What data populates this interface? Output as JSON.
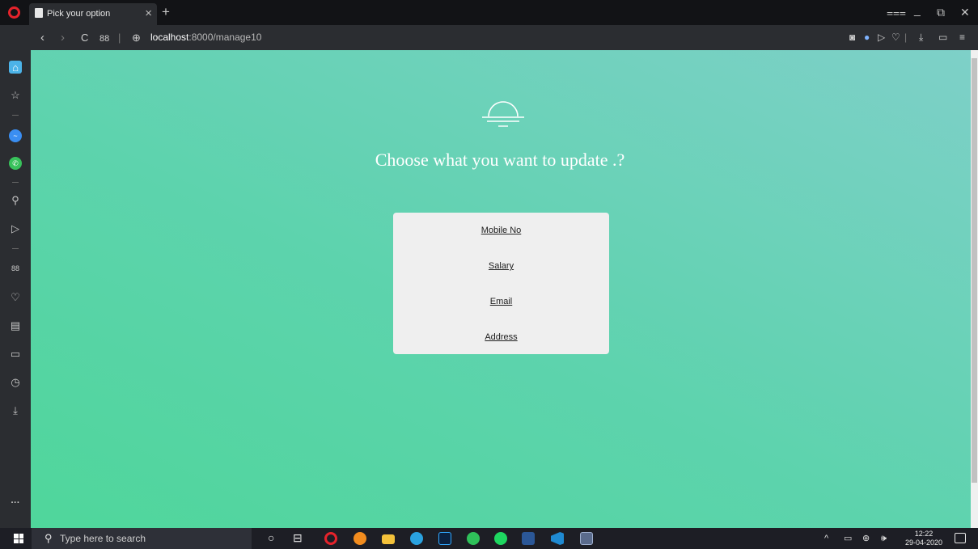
{
  "browser": {
    "tab": {
      "title": "Pick your option",
      "close_label": "×"
    },
    "new_tab_label": "+",
    "window_controls": {
      "menu": "⩶",
      "minimize": "_",
      "restore": "⧉",
      "close": "✕"
    },
    "nav": {
      "back": "‹",
      "forward": "›",
      "reload": "C",
      "speed_dial": "88",
      "separator": "|",
      "site_icon": "⊕"
    },
    "url": {
      "host": "localhost",
      "path": ":8000/manage10"
    },
    "address_icons": {
      "snapshot": "◙",
      "vpn": "●",
      "send": "▷",
      "heart": "♡",
      "divider": "|",
      "download": "⤓",
      "battery": "▭",
      "easy_setup": "≡"
    }
  },
  "sidebar": {
    "items": [
      {
        "name": "home-icon",
        "glyph": "⌂"
      },
      {
        "name": "star-icon",
        "glyph": "☆"
      },
      {
        "name": "messenger-icon",
        "glyph": "~"
      },
      {
        "name": "whatsapp-icon",
        "glyph": "✆"
      },
      {
        "name": "search-icon",
        "glyph": "⚲"
      },
      {
        "name": "send-icon",
        "glyph": "▷"
      },
      {
        "name": "apps-icon",
        "glyph": "88"
      },
      {
        "name": "heart-icon",
        "glyph": "♡"
      },
      {
        "name": "news-icon",
        "glyph": "▤"
      },
      {
        "name": "display-icon",
        "glyph": "▭"
      },
      {
        "name": "history-icon",
        "glyph": "◷"
      },
      {
        "name": "download-icon",
        "glyph": "⤓"
      },
      {
        "name": "more-icon",
        "glyph": "···"
      }
    ]
  },
  "page": {
    "heading": "Choose what you want to update .?",
    "options": [
      "Mobile No",
      "Salary",
      "Email",
      "Address"
    ],
    "colors": {
      "gradient_start": "#4fd69b",
      "gradient_end": "#7ed0c8",
      "card": "#efefef"
    }
  },
  "taskbar": {
    "search_placeholder": "Type here to search",
    "search_icon_glyph": "⚲",
    "cortana_glyph": "○",
    "task_view_glyph": "⊟",
    "apps": [
      "opera",
      "firefox",
      "file-explorer",
      "telegram",
      "photoshop",
      "whatsapp",
      "spotify",
      "word",
      "vscode",
      "snipping"
    ],
    "tray": {
      "chevron": "^",
      "battery": "▭",
      "network": "⊕",
      "volume": "🕪"
    },
    "clock": {
      "time": "12:22",
      "date": "29-04-2020"
    }
  }
}
